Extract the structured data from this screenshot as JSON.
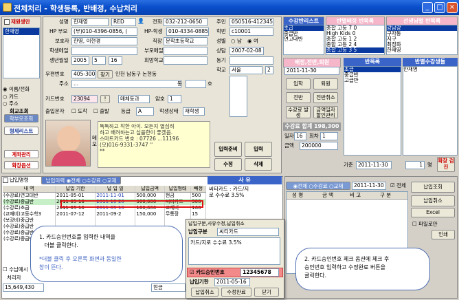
{
  "window": {
    "title": "전체처리 - 학생등록, 반배정, 수납처리",
    "min": "_",
    "max": "□",
    "close": "×"
  },
  "left": {
    "reenroll": "재원생만",
    "student": "한재영",
    "radio": [
      "이름/전화",
      "카드",
      "주소"
    ],
    "search_label": "회교조회",
    "tabs": [
      "학부모조회",
      "형제리스트",
      "계좌관리",
      "확장옵션"
    ]
  },
  "form": {
    "name_label": "성명",
    "name": "한재영",
    "color": "RED",
    "phone_label": "전화",
    "phone": "032-212-0650",
    "id_label": "주민",
    "id": "050516-4123456",
    "parent_hp_label": "HP 부모",
    "parent_hp": "(부)010-4396-0856, (",
    "student_hp_label": "HP-학생",
    "student_hp": "010-4334-0885",
    "student_no_label": "학번",
    "student_no": "c10001",
    "guardian_label": "보호자",
    "guardian": "한영, 이현경",
    "work_label": "직장",
    "work": "문학초등학교",
    "gender_label": "성별",
    "gender_m": "남",
    "gender_f": "여",
    "email_label": "학생메일",
    "parent_mail_label": "부모메일",
    "consult_label": "상담",
    "consult": "2007-02-08",
    "birth_label": "생년월일",
    "birth_y": "2005",
    "birth_m": "5",
    "birth_d": "16",
    "hope_label": "희망학교",
    "motive_label": "동기",
    "zip_label": "우편번호",
    "zip": "405-300",
    "find": "찾기",
    "addr1": "인천 남동구 논현동",
    "addr_label": "주소",
    "addr2": "...",
    "dong": "동",
    "ho": "호",
    "school_label": "학교",
    "school": "서울",
    "grade": "2",
    "card_label": "카드번호",
    "card": "23094",
    "card_btn": "!",
    "card_type": "매체등과",
    "pw_label": "암호",
    "pw": "1",
    "attend_label": "출입문자",
    "attend1": "도착",
    "attend2": "출발",
    "level_label": "등급",
    "level": "A",
    "status_label": "학생상태",
    "status": "재학생",
    "memo": [
      "똑똑하고 착한 아이. 모든지 열심히",
      "하고 배려하는고 싶을한이 좋겠음.",
      "스마트카드 번호 : 07726 ...11196",
      "(모)016-9331-3747 ''",
      "**"
    ],
    "memo_tag": "메모"
  },
  "mgmt": {
    "header": "수강반리스트",
    "items": [
      "초급",
      "중급반",
      "연고대반"
    ]
  },
  "classes": {
    "header": "반별배정 반목록",
    "items": [
      {
        "name": "종합 고등 7",
        "v": "0"
      },
      {
        "name": "High Kids",
        "v": "0"
      },
      {
        "name": "종합 고등 1",
        "v": "2"
      },
      {
        "name": "종합 고등 2",
        "v": "4"
      },
      {
        "name": "종합 고등 3",
        "v": "5"
      },
      {
        "name": "종합 고등 2",
        "v": "4"
      }
    ],
    "teacher_header": "선생님별 반목록",
    "teachers": [
      "강남강",
      "구자동",
      "지구",
      "최정화",
      "한재영"
    ]
  },
  "enroll": {
    "header": "배정,전반,퇴원",
    "date": "2011-11-30",
    "buttons": [
      "입학",
      "퇴원",
      "전반",
      "전반취소",
      "수강료 발생",
      "금액일자 할인관리"
    ],
    "summary_header": "수강료 합계 198,300",
    "days_label": "일자",
    "days": "16",
    "count_label": "회차",
    "count": "1",
    "amount_label": "금액",
    "amount": "200000"
  },
  "banlist": {
    "header": "반목록",
    "items": [
      "초급",
      "중급반",
      "고급반"
    ],
    "student_header": "반별수강생들",
    "students": [
      "한재영"
    ],
    "base_label": "기준",
    "base": "2011-11-30",
    "cnt": "1",
    "unit": "명",
    "confirm": "확장 검진"
  },
  "actions": {
    "prepare": "입력준비",
    "input": "입력",
    "edit": "수정",
    "delete": "삭제"
  },
  "lower": {
    "tab": "납입명령",
    "tab2": "납입미력",
    "filter": [
      "전체",
      "수강료",
      "교재"
    ],
    "memo_header": "사  유",
    "memo_text": [
      "씨티카드 : 카드/지",
      "로 수수료 3.5%"
    ],
    "columns": [
      "내  역",
      "납입 기한",
      "납 입 일",
      "납입금액",
      "납입형태",
      "빼정"
    ],
    "rows": [
      [
        "(수강료)연고대반",
        "2011-05-01",
        "2011-11-01",
        "500,000",
        "현금",
        "500"
      ],
      [
        "(수강료)중급반",
        "2011-05-16",
        "2011-10-20",
        "300,000",
        "씨티카드",
        "300"
      ],
      [
        "(수강료)초급",
        "2011-05-16",
        "2011-05-10",
        "160,000",
        "교재비",
        "160"
      ],
      [
        "(교재비)고등수학3",
        "2011-07-12",
        "2011-09-2",
        "150,000",
        "무통장",
        "15"
      ],
      [
        "(보강비)중급반",
        "",
        "",
        "",
        "",
        ""
      ],
      [
        "(수강료)중급반",
        "",
        "",
        "",
        "",
        ""
      ],
      [
        "(수강료)중급반",
        "",
        "",
        "",
        "",
        ""
      ],
      [
        "(수강료)중급반",
        "",
        "",
        "",
        "",
        ""
      ]
    ],
    "fee_label": "수납예시",
    "handler": "처리자",
    "total": "15,649,430",
    "cash": "현금"
  },
  "right": {
    "filter": [
      "전체",
      "수강료",
      "교재"
    ],
    "date": "2011-11-30",
    "all": "전체",
    "columns": [
      "성  명",
      "금 액",
      "비  고",
      "구 분"
    ],
    "buttons": [
      "납입조회",
      "납입취소",
      "Excel"
    ],
    "file_only": "파일로만",
    "print": "인쇄"
  },
  "dialog": {
    "title": "납입구분,사유수정,납입취소",
    "type_label": "납입구분",
    "type": "씨티카드",
    "text": [
      "카드/지로 수수료 3.5%"
    ],
    "approval_label": "카드승인번호",
    "approval": "12345678",
    "due_label": "납입기한",
    "due": "2011-05-16",
    "cancel": "납입취소",
    "done": "수정완료",
    "close": "닫기"
  },
  "callout1": {
    "lines": [
      "1. 카드승인번호를 입력한 내역을",
      "   더블 클릭한다."
    ],
    "note": [
      "*더블 클릭 후 오른쪽 화면과 동일한",
      "창이 뜬다."
    ]
  },
  "callout2": {
    "lines": [
      "2. 카드승인번호 체크 옵션에 체크 후",
      "승인번호 입력하고 수정완료 버튼을",
      "클릭한다."
    ]
  }
}
